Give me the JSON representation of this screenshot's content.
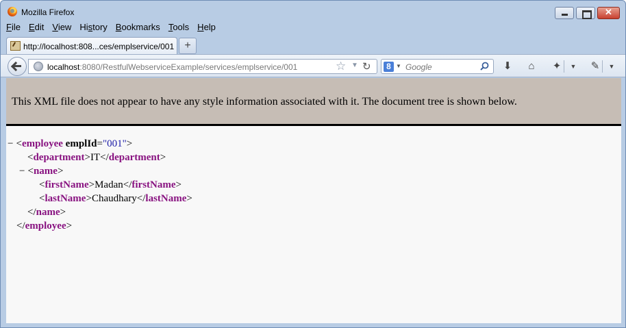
{
  "window": {
    "title": "Mozilla Firefox"
  },
  "menu": [
    {
      "key": "F",
      "rest": "ile"
    },
    {
      "key": "E",
      "rest": "dit"
    },
    {
      "key": "V",
      "rest": "iew"
    },
    {
      "pre": "Hi",
      "key": "s",
      "rest": "tory"
    },
    {
      "key": "B",
      "rest": "ookmarks"
    },
    {
      "key": "T",
      "rest": "ools"
    },
    {
      "key": "H",
      "rest": "elp"
    }
  ],
  "tab": {
    "title": "http://localhost:808...ces/emplservice/001",
    "new_tab_label": "+"
  },
  "address": {
    "host": "localhost",
    "rest": ":8080/RestfulWebserviceExample/services/emplservice/001"
  },
  "search": {
    "placeholder": "Google",
    "engine_letter": "8"
  },
  "banner": {
    "text": "This XML file does not appear to have any style information associated with it. The document tree is shown below."
  },
  "xml": {
    "fold_symbol": "−",
    "employee": {
      "tag": "employee",
      "attr_name": "emplId",
      "attr_value": "\"001\""
    },
    "department": {
      "tag": "department",
      "text": "IT"
    },
    "name": {
      "tag": "name"
    },
    "firstName": {
      "tag": "firstName",
      "text": "Madan"
    },
    "lastName": {
      "tag": "lastName",
      "text": "Chaudhary"
    }
  },
  "icons": [
    "firefox-logo-icon",
    "minimize-icon",
    "maximize-icon",
    "close-icon",
    "back-arrow-icon",
    "globe-icon",
    "star-icon",
    "reload-icon",
    "google-icon",
    "search-icon",
    "download-icon",
    "home-icon",
    "addon-icon",
    "developer-icon"
  ]
}
